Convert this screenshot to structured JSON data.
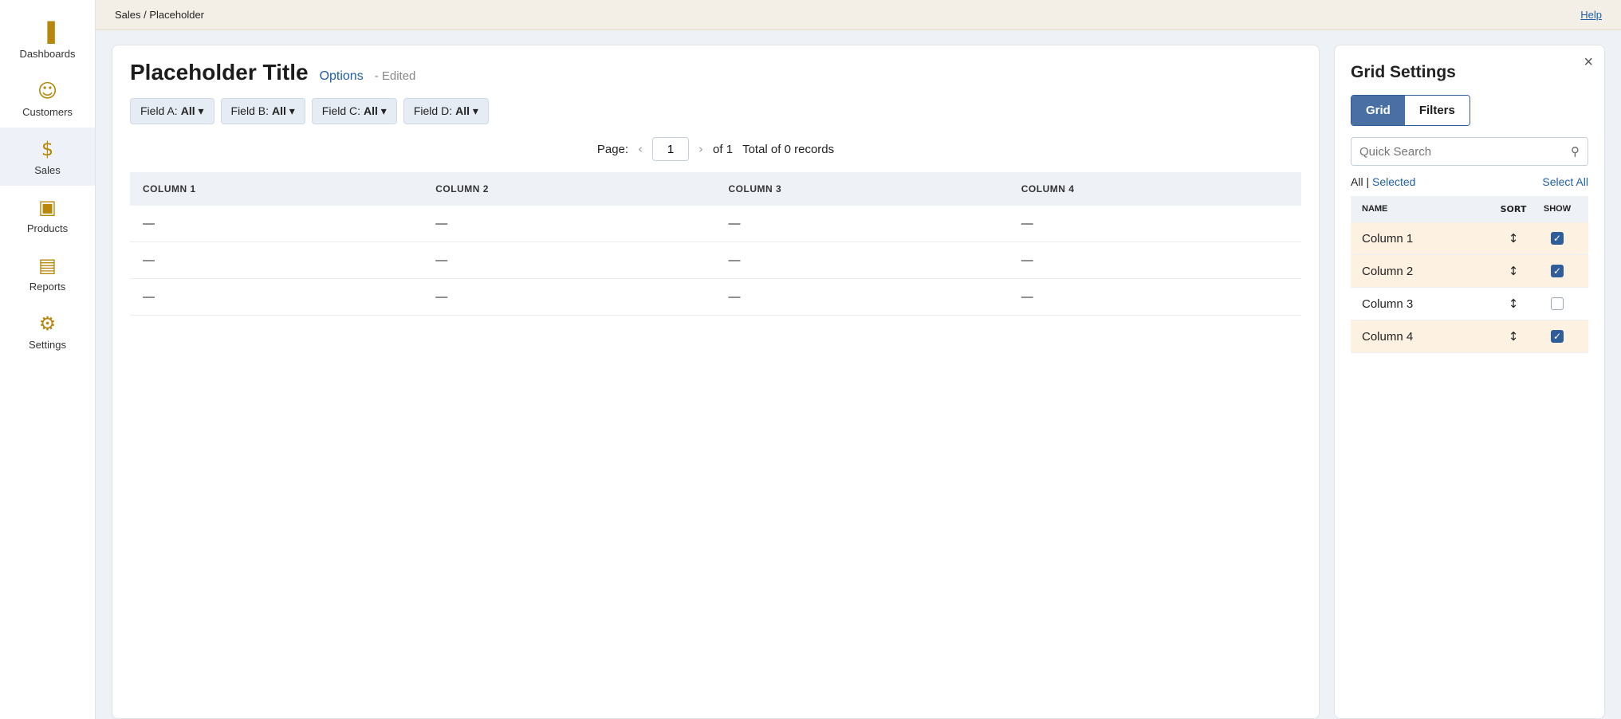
{
  "sidebar": {
    "items": [
      {
        "label": "Dashboards",
        "icon": "chart-icon",
        "glyph": "▐"
      },
      {
        "label": "Customers",
        "icon": "users-icon",
        "glyph": "☺"
      },
      {
        "label": "Sales",
        "icon": "dollar-icon",
        "glyph": "$"
      },
      {
        "label": "Products",
        "icon": "box-icon",
        "glyph": "▣"
      },
      {
        "label": "Reports",
        "icon": "folder-icon",
        "glyph": "▤"
      },
      {
        "label": "Settings",
        "icon": "gear-icon",
        "glyph": "⚙"
      }
    ]
  },
  "topbar": {
    "breadcrumb": "Sales / Placeholder",
    "help_link": "Help"
  },
  "header": {
    "title": "Placeholder Title",
    "options_label": "Options",
    "status": "- Edited"
  },
  "filters": [
    {
      "label": "Field A:",
      "value": "All"
    },
    {
      "label": "Field B:",
      "value": "All"
    },
    {
      "label": "Field C:",
      "value": "All"
    },
    {
      "label": "Field D:",
      "value": "All"
    }
  ],
  "pager": {
    "page_label": "Page:",
    "page_value": "1",
    "of_label": "of 1",
    "total": "Total of 0 records"
  },
  "table": {
    "columns": [
      "Column 1",
      "Column 2",
      "Column 3",
      "Column 4"
    ],
    "rows": [
      [
        "—",
        "—",
        "—",
        "—"
      ],
      [
        "—",
        "—",
        "—",
        "—"
      ],
      [
        "—",
        "—",
        "—",
        "—"
      ]
    ]
  },
  "grid_settings": {
    "title": "Grid Settings",
    "close": "×",
    "tabs": [
      "Grid",
      "Filters"
    ],
    "search_placeholder": "Quick Search",
    "search_glyph": "⚲",
    "scope_all": "All",
    "scope_selected": "Selected",
    "select_all": "Select All",
    "headers": {
      "name": "Name",
      "sort": "Sort",
      "show": "Show"
    },
    "sort_glyph": "↕",
    "columns": [
      {
        "name": "Column 1",
        "shown": true
      },
      {
        "name": "Column 2",
        "shown": true
      },
      {
        "name": "Column 3",
        "shown": false
      },
      {
        "name": "Column 4",
        "shown": true
      }
    ]
  }
}
